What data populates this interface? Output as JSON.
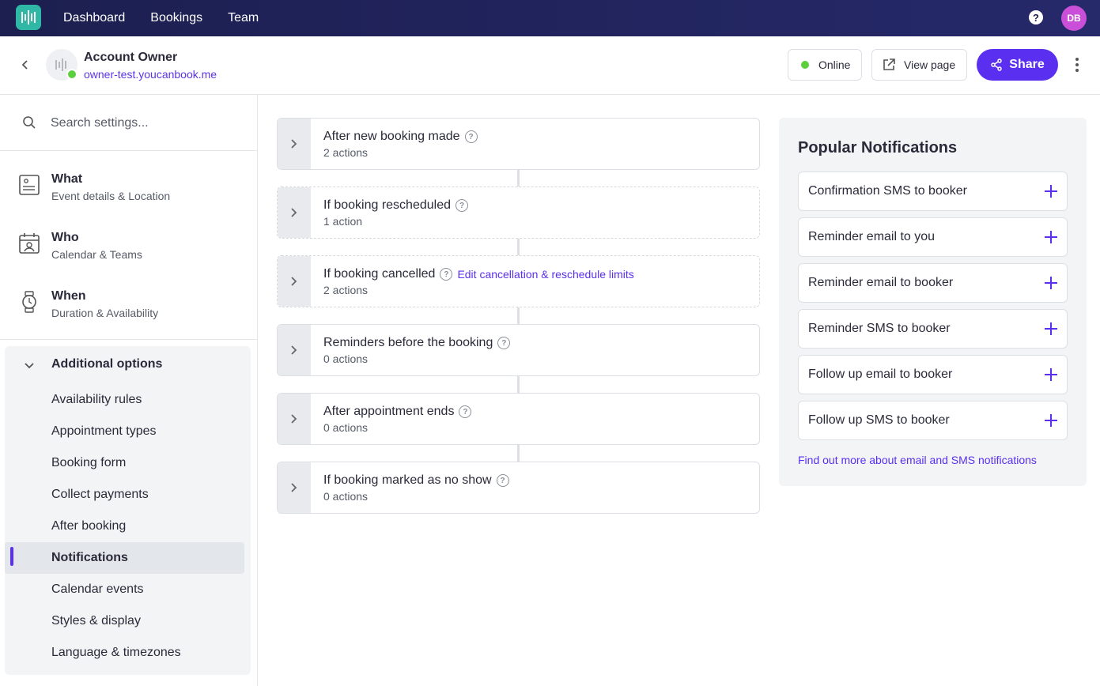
{
  "nav": {
    "links": [
      "Dashboard",
      "Bookings",
      "Team"
    ],
    "help_glyph": "?",
    "user_initials": "DB"
  },
  "header": {
    "account_name": "Account Owner",
    "account_url": "owner-test.youcanbook.me",
    "status_label": "Online",
    "view_page_label": "View page",
    "share_label": "Share"
  },
  "sidebar": {
    "search_placeholder": "Search settings...",
    "main_items": [
      {
        "title": "What",
        "subtitle": "Event details & Location",
        "icon": "form-icon"
      },
      {
        "title": "Who",
        "subtitle": "Calendar & Teams",
        "icon": "contact-calendar-icon"
      },
      {
        "title": "When",
        "subtitle": "Duration & Availability",
        "icon": "watch-icon"
      }
    ],
    "additional_title": "Additional options",
    "sub_items": [
      "Availability rules",
      "Appointment types",
      "Booking form",
      "Collect payments",
      "After booking",
      "Notifications",
      "Calendar events",
      "Styles & display",
      "Language & timezones"
    ],
    "active_item": "Notifications"
  },
  "workflow": [
    {
      "title": "After new booking made",
      "count": "2 actions"
    },
    {
      "title": "If booking rescheduled",
      "count": "1 action"
    },
    {
      "title": "If booking cancelled",
      "count": "2 actions",
      "link": "Edit cancellation & reschedule limits"
    },
    {
      "title": "Reminders before the booking",
      "count": "0 actions"
    },
    {
      "title": "After appointment ends",
      "count": "0 actions"
    },
    {
      "title": "If booking marked as no show",
      "count": "0 actions"
    }
  ],
  "popular": {
    "title": "Popular Notifications",
    "items": [
      "Confirmation SMS to booker",
      "Reminder email to you",
      "Reminder email to booker",
      "Reminder SMS to booker",
      "Follow up email to booker",
      "Follow up SMS to booker"
    ],
    "more_link": "Find out more about email and SMS notifications"
  },
  "colors": {
    "accent": "#5a2ff0",
    "online": "#5ccf3f",
    "nav_bg": "#1c1f4f",
    "logo": "#2fb8a6",
    "avatar": "#c94fd9"
  }
}
